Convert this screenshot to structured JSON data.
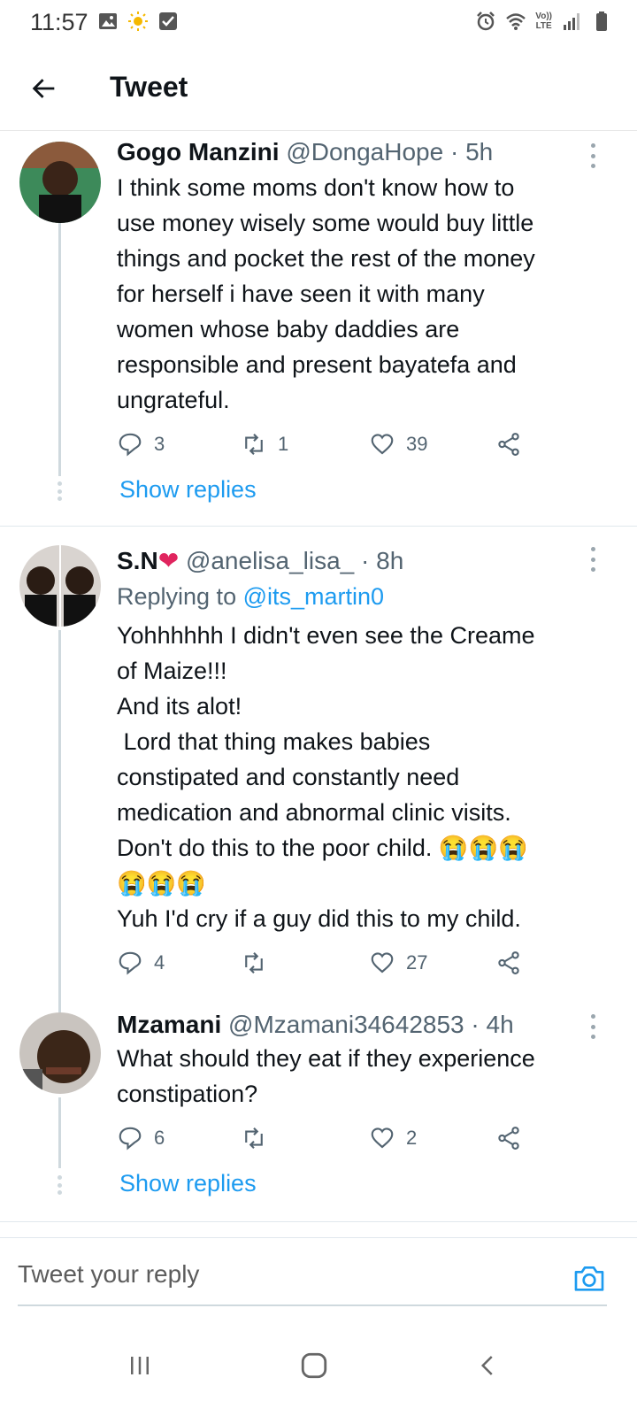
{
  "status_bar": {
    "time": "11:57",
    "left_icons": [
      "gallery-icon",
      "sun-icon",
      "checkbox-icon"
    ],
    "right_icons": [
      "alarm-icon",
      "wifi-icon",
      "volte-icon",
      "signal-icon",
      "battery-icon"
    ],
    "volte_top": "Vo))",
    "volte_bottom": "LTE"
  },
  "header": {
    "back_icon": "arrow-left-icon",
    "title": "Tweet"
  },
  "tweets": [
    {
      "name": "Gogo Manzini",
      "meta": "@DongaHope · 5h",
      "text": "I think some moms don't know how to\nuse money wisely some would buy little\nthings and pocket the rest of the money\nfor herself i have seen it with many\nwomen whose baby daddies are\nresponsible and present bayatefa and\nungrateful.",
      "replies": "3",
      "retweets": "1",
      "likes": "39",
      "show_replies": "Show replies"
    },
    {
      "name": "S.N",
      "heart": "❤",
      "meta": "@anelisa_lisa_ · 8h",
      "replying_prefix": "Replying to ",
      "replying_handle": "@its_martin0",
      "text": "Yohhhhhh I didn't even see the Creame\nof Maize!!!\nAnd its alot!\n Lord that thing makes babies\nconstipated and constantly need\nmedication and abnormal clinic visits.\nDon't do this to the poor child. 😭😭😭\n😭😭😭\nYuh I'd cry if a guy did this to my child.",
      "replies": "4",
      "retweets": "",
      "likes": "27"
    },
    {
      "name": "Mzamani",
      "meta": "@Mzamani34642853 · 4h",
      "text": "What should they eat if they experience\nconstipation?",
      "replies": "6",
      "retweets": "",
      "likes": "2",
      "show_replies": "Show replies"
    }
  ],
  "composer": {
    "placeholder": "Tweet your reply",
    "camera_icon": "camera-icon"
  },
  "nav_bar": {
    "icons": [
      "recents-icon",
      "home-icon",
      "back-icon"
    ]
  },
  "colors": {
    "accent": "#1d9bf0",
    "secondary_text": "#536471",
    "thread_line": "#cfd9de"
  }
}
